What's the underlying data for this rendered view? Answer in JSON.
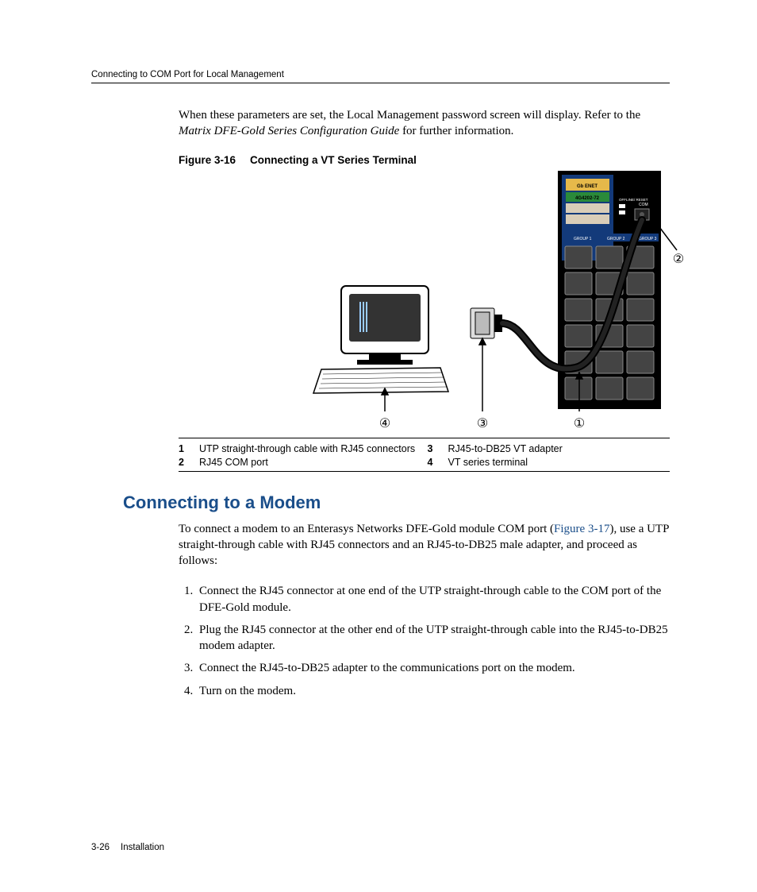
{
  "header": {
    "title": "Connecting to COM Port for Local Management"
  },
  "intro": {
    "text_before_italic": "When these parameters are set, the Local Management password screen will display. Refer to the ",
    "italic": "Matrix DFE-Gold Series Configuration Guide",
    "text_after_italic": " for further information."
  },
  "figure": {
    "label": "Figure 3-16",
    "title": "Connecting a VT Series Terminal",
    "module_labels": {
      "row1": "Gb ENET",
      "row2": "4G4202-72",
      "reset": "OFFLINE/ RESET",
      "com": "COM",
      "group1": "GROUP 1",
      "group2": "GROUP 2",
      "group3": "GROUP 3"
    },
    "callouts": {
      "c1": "①",
      "c2": "②",
      "c3": "③",
      "c4": "④"
    }
  },
  "legend": {
    "items": [
      {
        "n": "1",
        "t": "UTP straight-through cable with RJ45 connectors"
      },
      {
        "n": "2",
        "t": "RJ45 COM port"
      },
      {
        "n": "3",
        "t": "RJ45-to-DB25 VT adapter"
      },
      {
        "n": "4",
        "t": "VT series terminal"
      }
    ]
  },
  "section": {
    "heading": "Connecting to a Modem",
    "p_before_link": "To connect a modem to an Enterasys Networks DFE-Gold module COM port (",
    "link": "Figure 3-17",
    "p_after_link": "), use a UTP straight-through cable with RJ45 connectors and an RJ45-to-DB25 male adapter, and proceed as follows:",
    "steps": [
      "Connect the RJ45 connector at one end of the UTP straight-through cable to the COM port of the DFE-Gold module.",
      "Plug the RJ45 connector at the other end of the UTP straight-through cable into the RJ45-to-DB25 modem adapter.",
      "Connect the RJ45-to-DB25 adapter to the communications port on the modem.",
      "Turn on the modem."
    ]
  },
  "footer": {
    "page": "3-26",
    "chapter": "Installation"
  }
}
